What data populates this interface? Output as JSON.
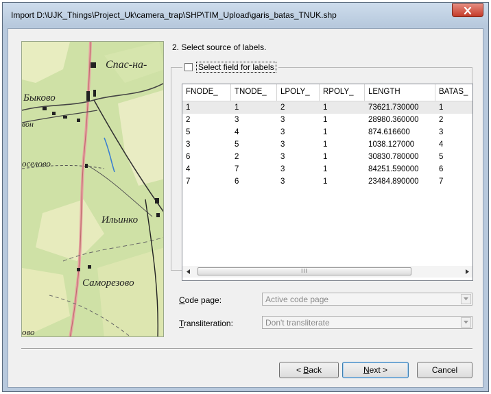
{
  "window": {
    "title": "Import D:\\UJK_Things\\Project_Uk\\camera_trap\\SHP\\TIM_Upload\\garis_batas_TNUK.shp",
    "close_icon": "close-x-icon"
  },
  "map_preview": {
    "place_labels": [
      "Спас-на-",
      "Быково",
      "вон",
      "оселово",
      "Ильинко",
      "Саморезово",
      "ово"
    ]
  },
  "wizard": {
    "step_heading": "2. Select source of labels."
  },
  "labels_group": {
    "checkbox_label": "Select field for labels",
    "checkbox_checked": false
  },
  "table": {
    "columns": [
      "FNODE_",
      "TNODE_",
      "LPOLY_",
      "RPOLY_",
      "LENGTH",
      "BATAS_"
    ],
    "rows": [
      [
        "1",
        "1",
        "2",
        "1",
        "73621.730000",
        "1"
      ],
      [
        "2",
        "3",
        "3",
        "1",
        "28980.360000",
        "2"
      ],
      [
        "5",
        "4",
        "3",
        "1",
        "874.616600",
        "3"
      ],
      [
        "3",
        "5",
        "3",
        "1",
        "1038.127000",
        "4"
      ],
      [
        "6",
        "2",
        "3",
        "1",
        "30830.780000",
        "5"
      ],
      [
        "4",
        "7",
        "3",
        "1",
        "84251.590000",
        "6"
      ],
      [
        "7",
        "6",
        "3",
        "1",
        "23484.890000",
        "7"
      ]
    ],
    "selected_row": 0,
    "scrollbar": {
      "left_icon": "arrow-left-icon",
      "right_icon": "arrow-right-icon",
      "grip": "III"
    }
  },
  "code_page": {
    "label_accel": "C",
    "label_rest": "ode page:",
    "value": "Active code page"
  },
  "transliteration": {
    "label_accel": "T",
    "label_rest": "ransliteration:",
    "value": "Don't transliterate"
  },
  "buttons": {
    "back_prefix": "< ",
    "back_accel": "B",
    "back_rest": "ack",
    "next_accel": "N",
    "next_rest": "ext >",
    "cancel": "Cancel"
  },
  "colors": {
    "title_bar": "#b9cbe0",
    "close_button": "#c94a3a",
    "dialog_bg": "#f0f0f0",
    "map_bg": "#cfe1a6",
    "default_button_border": "#3c7fb1"
  }
}
